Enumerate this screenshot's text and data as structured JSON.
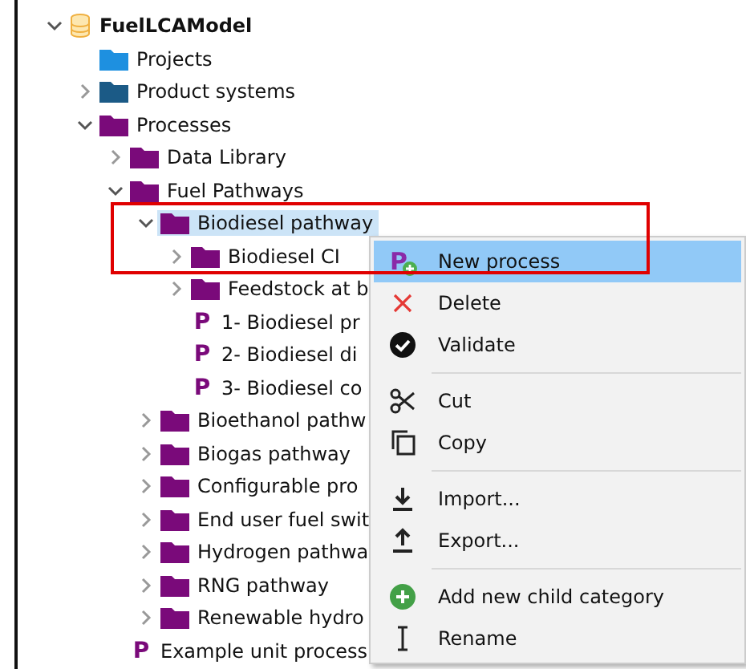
{
  "tree": [
    {
      "label": "FuelLCAModel",
      "kind": "database",
      "expanded": true,
      "selected": false,
      "children": [
        {
          "label": "Projects",
          "kind": "folder",
          "color": "#1e90e0",
          "selected": false
        },
        {
          "label": "Product systems",
          "kind": "folder",
          "color": "#1b5a86",
          "expanded": false,
          "selected": false
        },
        {
          "label": "Processes",
          "kind": "folder",
          "color": "#7a0a7a",
          "expanded": true,
          "selected": false,
          "children": [
            {
              "label": "Data Library",
              "kind": "folder",
              "color": "#7a0a7a",
              "expanded": false,
              "selected": false
            },
            {
              "label": "Fuel Pathways",
              "kind": "folder",
              "color": "#7a0a7a",
              "expanded": true,
              "selected": false,
              "children": [
                {
                  "label": "Biodiesel pathway",
                  "kind": "folder",
                  "color": "#7a0a7a",
                  "expanded": true,
                  "selected": true,
                  "children": [
                    {
                      "label": "Biodiesel CI",
                      "kind": "folder",
                      "color": "#7a0a7a",
                      "expanded": false,
                      "selected": false
                    },
                    {
                      "label": "Feedstock at b",
                      "kind": "folder",
                      "color": "#7a0a7a",
                      "expanded": false,
                      "selected": false
                    },
                    {
                      "label": "1- Biodiesel pr",
                      "kind": "process",
                      "glyph": "P",
                      "selected": false
                    },
                    {
                      "label": "2- Biodiesel di",
                      "kind": "process",
                      "glyph": "P",
                      "selected": false
                    },
                    {
                      "label": "3- Biodiesel co",
                      "kind": "process",
                      "glyph": "P",
                      "selected": false
                    }
                  ]
                },
                {
                  "label": "Bioethanol pathw",
                  "kind": "folder",
                  "color": "#7a0a7a",
                  "expanded": false,
                  "selected": false
                },
                {
                  "label": "Biogas pathway",
                  "kind": "folder",
                  "color": "#7a0a7a",
                  "expanded": false,
                  "selected": false
                },
                {
                  "label": "Configurable pro",
                  "kind": "folder",
                  "color": "#7a0a7a",
                  "expanded": false,
                  "selected": false
                },
                {
                  "label": "End user fuel swit",
                  "kind": "folder",
                  "color": "#7a0a7a",
                  "expanded": false,
                  "selected": false
                },
                {
                  "label": "Hydrogen pathwa",
                  "kind": "folder",
                  "color": "#7a0a7a",
                  "expanded": false,
                  "selected": false
                },
                {
                  "label": "RNG pathway",
                  "kind": "folder",
                  "color": "#7a0a7a",
                  "expanded": false,
                  "selected": false
                },
                {
                  "label": "Renewable hydro",
                  "kind": "folder",
                  "color": "#7a0a7a",
                  "expanded": false,
                  "selected": false
                }
              ]
            },
            {
              "label": "Example unit process",
              "kind": "process",
              "glyph": "P",
              "selected": false
            }
          ]
        }
      ]
    }
  ],
  "context_menu": {
    "groups": [
      [
        {
          "label": "New process",
          "kind": "new",
          "glyph": "P",
          "selected": true
        },
        {
          "label": "Delete",
          "kind": "delete",
          "selected": false
        },
        {
          "label": "Validate",
          "kind": "validate",
          "selected": false
        }
      ],
      [
        {
          "label": "Cut",
          "kind": "cut",
          "selected": false
        },
        {
          "label": "Copy",
          "kind": "copy",
          "selected": false
        }
      ],
      [
        {
          "label": "Import...",
          "kind": "import",
          "selected": false
        },
        {
          "label": "Export...",
          "kind": "export",
          "selected": false
        }
      ],
      [
        {
          "label": "Add new child category",
          "kind": "add",
          "selected": false
        },
        {
          "label": "Rename",
          "kind": "rename",
          "selected": false
        }
      ]
    ]
  }
}
